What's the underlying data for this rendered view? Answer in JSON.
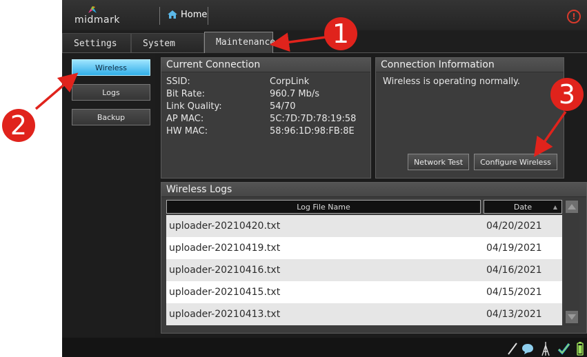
{
  "header": {
    "brand": "midmark",
    "home_label": "Home",
    "alert_symbol": "!"
  },
  "tabs": [
    {
      "label": "Settings"
    },
    {
      "label": "System"
    },
    {
      "label": "Maintenance",
      "active": true
    }
  ],
  "sidebar": {
    "items": [
      {
        "label": "Wireless",
        "active": true
      },
      {
        "label": "Logs"
      },
      {
        "label": "Backup"
      }
    ]
  },
  "current_connection": {
    "title": "Current Connection",
    "fields": [
      {
        "label": "SSID:",
        "value": "CorpLink"
      },
      {
        "label": "Bit Rate:",
        "value": "960.7 Mb/s"
      },
      {
        "label": "Link Quality:",
        "value": "54/70"
      },
      {
        "label": "AP MAC:",
        "value": "5C:7D:7D:78:19:58"
      },
      {
        "label": "HW MAC:",
        "value": "58:96:1D:98:FB:8E"
      }
    ]
  },
  "connection_info": {
    "title": "Connection Information",
    "message": "Wireless is operating normally.",
    "network_test_label": "Network Test",
    "configure_wireless_label": "Configure Wireless"
  },
  "wireless_logs": {
    "title": "Wireless Logs",
    "columns": [
      "Log File Name",
      "Date"
    ],
    "sort_indicator": "▲",
    "rows": [
      {
        "name": "uploader-20210420.txt",
        "date": "04/20/2021"
      },
      {
        "name": "uploader-20210419.txt",
        "date": "04/19/2021"
      },
      {
        "name": "uploader-20210416.txt",
        "date": "04/16/2021"
      },
      {
        "name": "uploader-20210415.txt",
        "date": "04/15/2021"
      },
      {
        "name": "uploader-20210413.txt",
        "date": "04/13/2021"
      }
    ]
  },
  "callouts": [
    "1",
    "2",
    "3"
  ],
  "colors": {
    "callout_red": "#e0231c",
    "active_blue": "#31aee8",
    "row_odd": "#e6e6e6",
    "row_even": "#ffffff"
  }
}
